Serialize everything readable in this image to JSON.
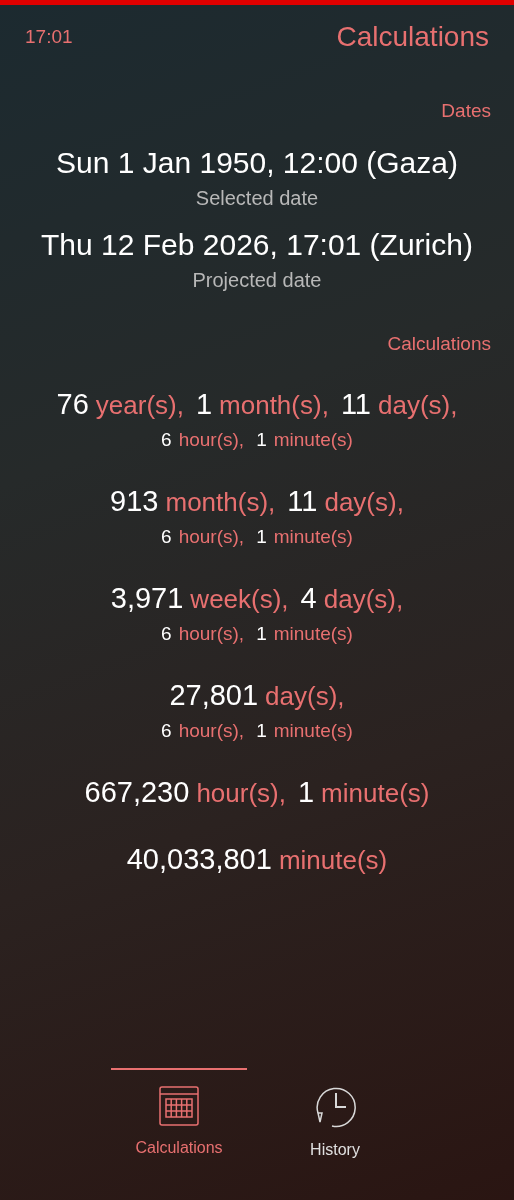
{
  "status_bar": {
    "time": "17:01"
  },
  "page_title": "Calculations",
  "dates": {
    "header": "Dates",
    "items": [
      {
        "value": "Sun 1 Jan 1950, 12:00 (Gaza)",
        "label": "Selected date"
      },
      {
        "value": "Thu 12 Feb 2026, 17:01 (Zurich)",
        "label": "Projected date"
      }
    ]
  },
  "calculations": {
    "header": "Calculations",
    "results": [
      {
        "lines": [
          {
            "kind": "main",
            "parts": [
              {
                "number": "76",
                "unit": "year(s),"
              },
              {
                "number": "1",
                "unit": "month(s),"
              },
              {
                "number": "11",
                "unit": "day(s),"
              }
            ]
          },
          {
            "kind": "sub",
            "parts": [
              {
                "number": "6",
                "unit": "hour(s),"
              },
              {
                "number": "1",
                "unit": "minute(s)"
              }
            ]
          }
        ]
      },
      {
        "lines": [
          {
            "kind": "main",
            "parts": [
              {
                "number": "913",
                "unit": "month(s),"
              },
              {
                "number": "11",
                "unit": "day(s),"
              }
            ]
          },
          {
            "kind": "sub",
            "parts": [
              {
                "number": "6",
                "unit": "hour(s),"
              },
              {
                "number": "1",
                "unit": "minute(s)"
              }
            ]
          }
        ]
      },
      {
        "lines": [
          {
            "kind": "main",
            "parts": [
              {
                "number": "3,971",
                "unit": "week(s),"
              },
              {
                "number": "4",
                "unit": "day(s),"
              }
            ]
          },
          {
            "kind": "sub",
            "parts": [
              {
                "number": "6",
                "unit": "hour(s),"
              },
              {
                "number": "1",
                "unit": "minute(s)"
              }
            ]
          }
        ]
      },
      {
        "lines": [
          {
            "kind": "main",
            "parts": [
              {
                "number": "27,801",
                "unit": "day(s),"
              }
            ]
          },
          {
            "kind": "sub",
            "parts": [
              {
                "number": "6",
                "unit": "hour(s),"
              },
              {
                "number": "1",
                "unit": "minute(s)"
              }
            ]
          }
        ]
      },
      {
        "lines": [
          {
            "kind": "main",
            "parts": [
              {
                "number": "667,230",
                "unit": "hour(s),"
              },
              {
                "number": "1",
                "unit": "minute(s)"
              }
            ]
          }
        ]
      },
      {
        "lines": [
          {
            "kind": "main",
            "parts": [
              {
                "number": "40,033,801",
                "unit": "minute(s)"
              }
            ]
          }
        ]
      }
    ]
  },
  "tabs": [
    {
      "label": "Calculations",
      "kind": "calendar",
      "selected": true
    },
    {
      "label": "History",
      "kind": "clock",
      "selected": false
    }
  ]
}
